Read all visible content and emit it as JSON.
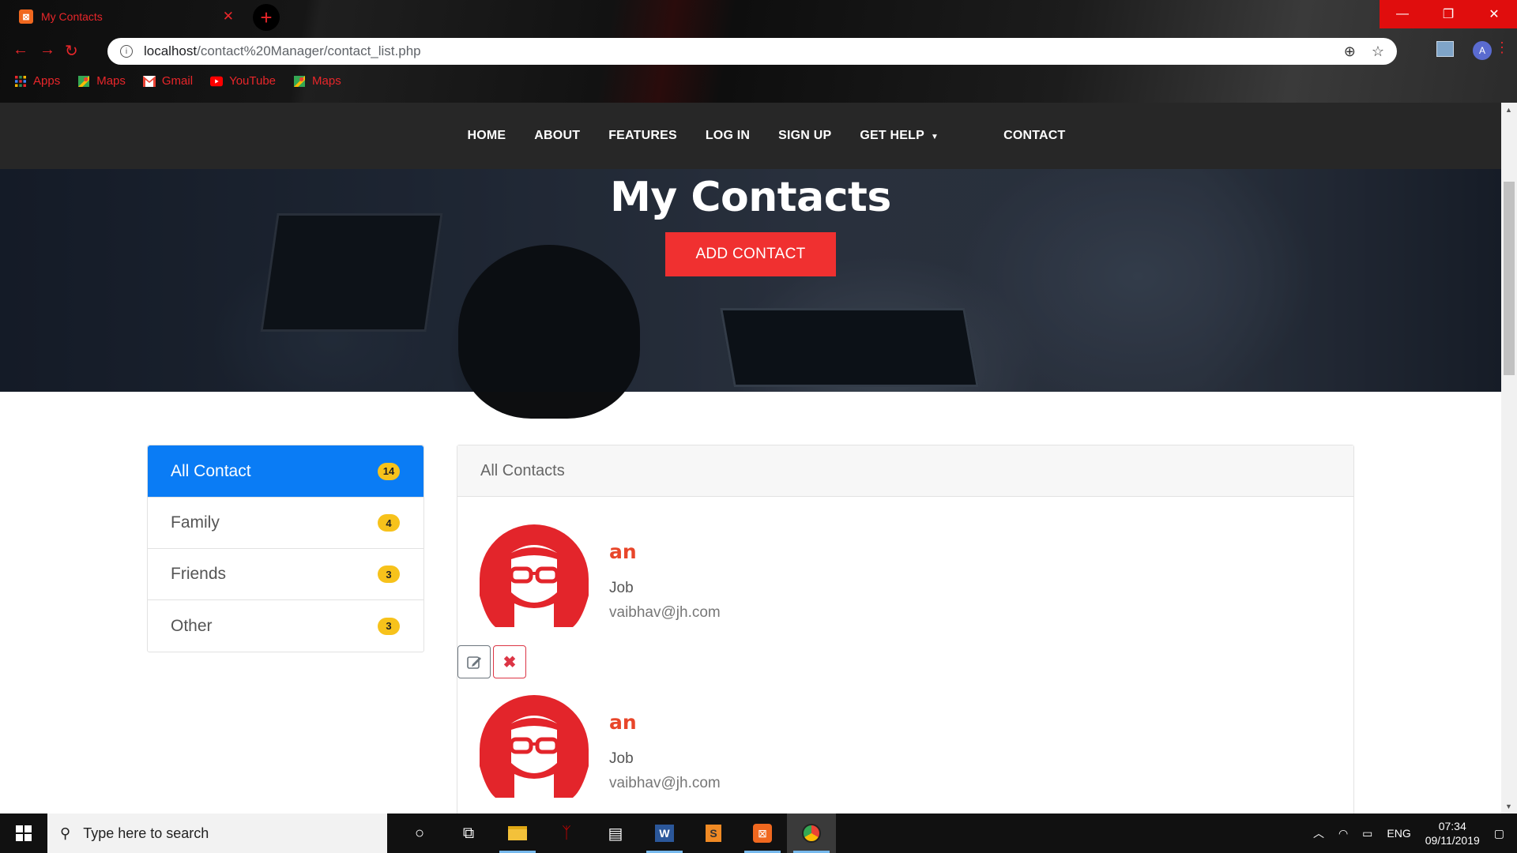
{
  "browser": {
    "tab_title": "My Contacts",
    "tab_close": "✕",
    "new_tab": "+",
    "url_host": "localhost",
    "url_path": "/contact%20Manager/contact_list.php",
    "profile_initial": "A",
    "bookmarks": [
      {
        "label": "Apps",
        "icon": "apps-grid-icon"
      },
      {
        "label": "Maps",
        "icon": "maps-icon"
      },
      {
        "label": "Gmail",
        "icon": "gmail-icon"
      },
      {
        "label": "YouTube",
        "icon": "youtube-icon"
      },
      {
        "label": "Maps",
        "icon": "maps-icon"
      }
    ]
  },
  "nav": {
    "items": [
      "HOME",
      "ABOUT",
      "FEATURES",
      "LOG IN",
      "SIGN UP",
      "GET HELP",
      "CONTACT"
    ]
  },
  "hero": {
    "title": "My Contacts",
    "add_button": "ADD CONTACT"
  },
  "sidebar": {
    "items": [
      {
        "label": "All Contact",
        "count": "14",
        "active": true
      },
      {
        "label": "Family",
        "count": "4",
        "active": false
      },
      {
        "label": "Friends",
        "count": "3",
        "active": false
      },
      {
        "label": "Other",
        "count": "3",
        "active": false
      }
    ]
  },
  "panel": {
    "heading": "All Contacts",
    "contacts": [
      {
        "name": "an",
        "job": "Job",
        "email": "vaibhav@jh.com"
      },
      {
        "name": "an",
        "job": "Job",
        "email": "vaibhav@jh.com"
      }
    ]
  },
  "taskbar": {
    "search_placeholder": "Type here to search",
    "lang": "ENG",
    "time": "07:34",
    "date": "09/11/2019"
  },
  "colors": {
    "accent_red": "#f03030",
    "active_blue": "#0a7cf5",
    "badge_yellow": "#f7c21b",
    "contact_name": "#e8462a"
  }
}
